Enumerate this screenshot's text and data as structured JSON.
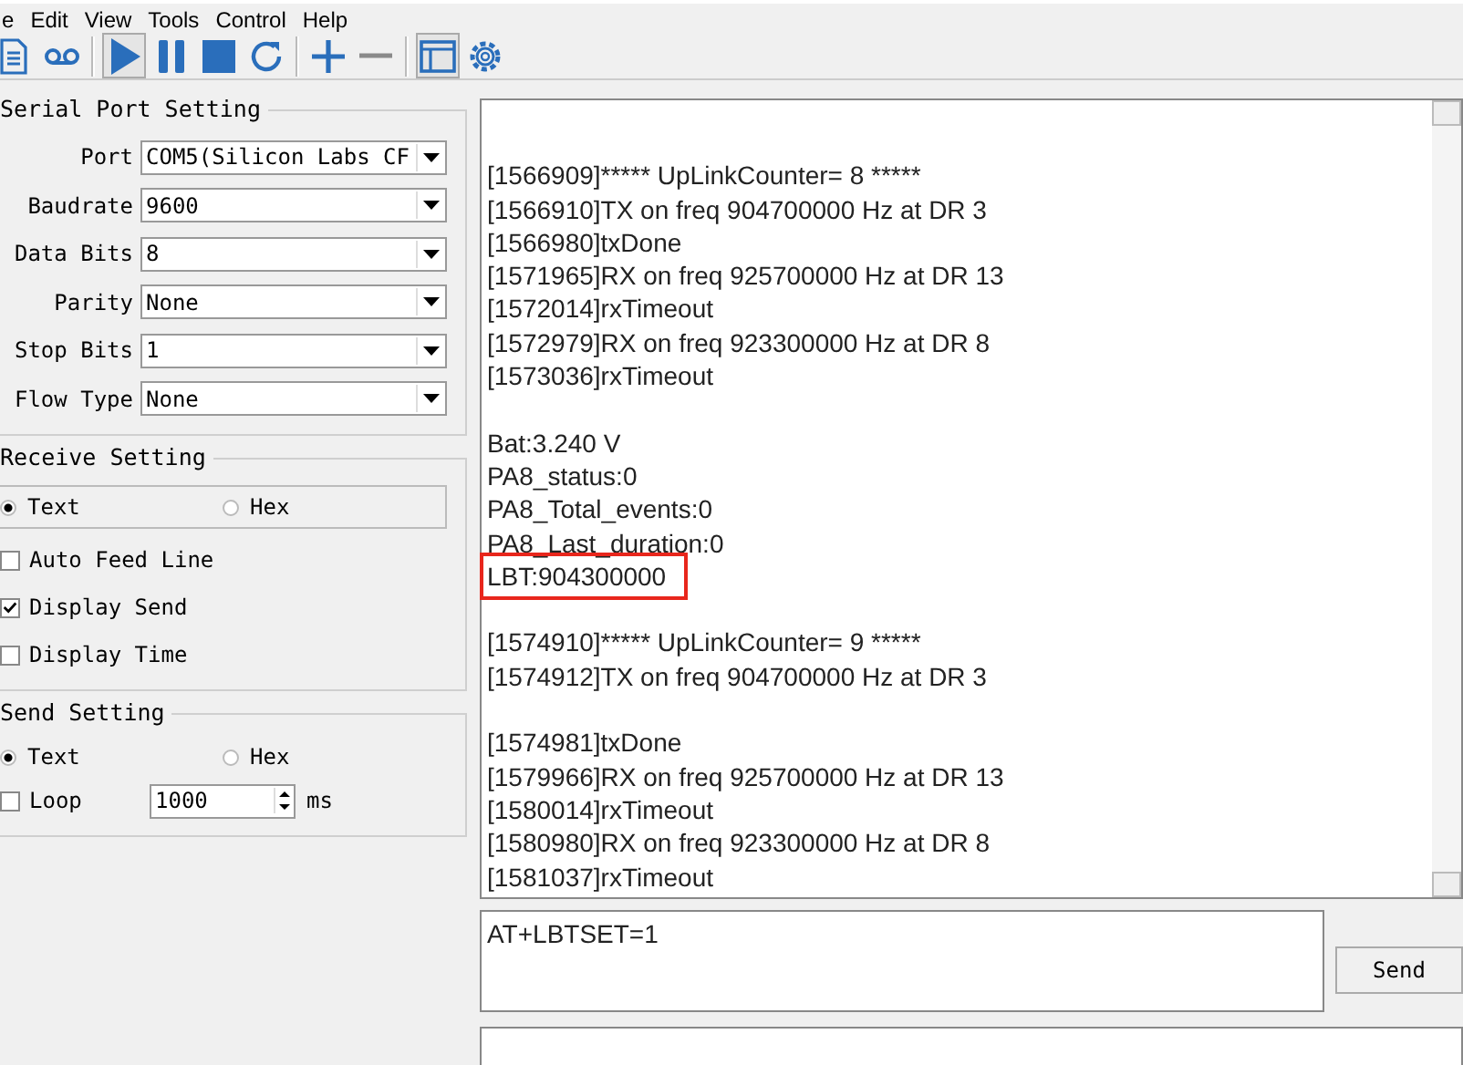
{
  "menu": [
    {
      "label": "e"
    },
    {
      "label": "Edit"
    },
    {
      "label": "View"
    },
    {
      "label": "Tools"
    },
    {
      "label": "Control"
    },
    {
      "label": "Help"
    }
  ],
  "toolbar": [
    {
      "kind": "document",
      "pressed": false
    },
    {
      "kind": "tape",
      "pressed": false
    },
    {
      "kind": "play",
      "pressed": true
    },
    {
      "kind": "pause",
      "pressed": false
    },
    {
      "kind": "stop",
      "pressed": false
    },
    {
      "kind": "refresh",
      "pressed": false
    },
    {
      "kind": "plus",
      "pressed": false
    },
    {
      "kind": "minus",
      "pressed": false
    },
    {
      "kind": "window",
      "pressed": true
    },
    {
      "kind": "gear",
      "pressed": false
    }
  ],
  "serial_port_setting": {
    "title": "Serial Port Setting",
    "fields": [
      {
        "label": "Port",
        "value": "COM5(Silicon Labs CF"
      },
      {
        "label": "Baudrate",
        "value": "9600"
      },
      {
        "label": "Data Bits",
        "value": "8"
      },
      {
        "label": "Parity",
        "value": "None"
      },
      {
        "label": "Stop Bits",
        "value": "1"
      },
      {
        "label": "Flow Type",
        "value": "None"
      }
    ]
  },
  "receive_setting": {
    "title": "Receive Setting",
    "modes": [
      {
        "label": "Text",
        "selected": true
      },
      {
        "label": "Hex",
        "selected": false
      }
    ],
    "options": [
      {
        "label": "Auto Feed Line",
        "checked": false
      },
      {
        "label": "Display Send",
        "checked": true
      },
      {
        "label": "Display Time",
        "checked": false
      }
    ]
  },
  "send_setting": {
    "title": "Send Setting",
    "modes": [
      {
        "label": "Text",
        "selected": true
      },
      {
        "label": "Hex",
        "selected": false
      }
    ],
    "loop": {
      "label": "Loop",
      "checked": false,
      "value": "1000",
      "unit": "ms"
    }
  },
  "log": {
    "lines": [
      {
        "text": "[1566909]***** UpLinkCounter= 8 *****",
        "gap_before": true,
        "highlighted": false
      },
      {
        "text": "[1566910]TX on freq 904700000 Hz at DR 3",
        "gap_before": false,
        "highlighted": false
      },
      {
        "text": "[1566980]txDone",
        "gap_before": false,
        "highlighted": false
      },
      {
        "text": "[1571965]RX on freq 925700000 Hz at DR 13",
        "gap_before": false,
        "highlighted": false
      },
      {
        "text": "[1572014]rxTimeout",
        "gap_before": false,
        "highlighted": false
      },
      {
        "text": "[1572979]RX on freq 923300000 Hz at DR 8",
        "gap_before": false,
        "highlighted": false
      },
      {
        "text": "[1573036]rxTimeout",
        "gap_before": false,
        "highlighted": false
      },
      {
        "text": "Bat:3.240 V",
        "gap_before": true,
        "highlighted": false
      },
      {
        "text": "PA8_status:0",
        "gap_before": false,
        "highlighted": false
      },
      {
        "text": "PA8_Total_events:0",
        "gap_before": false,
        "highlighted": false
      },
      {
        "text": "PA8_Last_duration:0",
        "gap_before": false,
        "highlighted": false
      },
      {
        "text": "LBT:904300000",
        "gap_before": false,
        "highlighted": true
      },
      {
        "text": "[1574910]***** UpLinkCounter= 9 *****",
        "gap_before": true,
        "highlighted": false
      },
      {
        "text": "[1574912]TX on freq 904700000 Hz at DR 3",
        "gap_before": false,
        "highlighted": false
      },
      {
        "text": "[1574981]txDone",
        "gap_before": true,
        "highlighted": false
      },
      {
        "text": "[1579966]RX on freq 925700000 Hz at DR 13",
        "gap_before": false,
        "highlighted": false
      },
      {
        "text": "[1580014]rxTimeout",
        "gap_before": false,
        "highlighted": false
      },
      {
        "text": "[1580980]RX on freq 923300000 Hz at DR 8",
        "gap_before": false,
        "highlighted": false
      },
      {
        "text": "[1581037]rxTimeout",
        "gap_before": false,
        "highlighted": false
      }
    ]
  },
  "send_box": {
    "value": "AT+LBTSET=1",
    "button": "Send"
  }
}
